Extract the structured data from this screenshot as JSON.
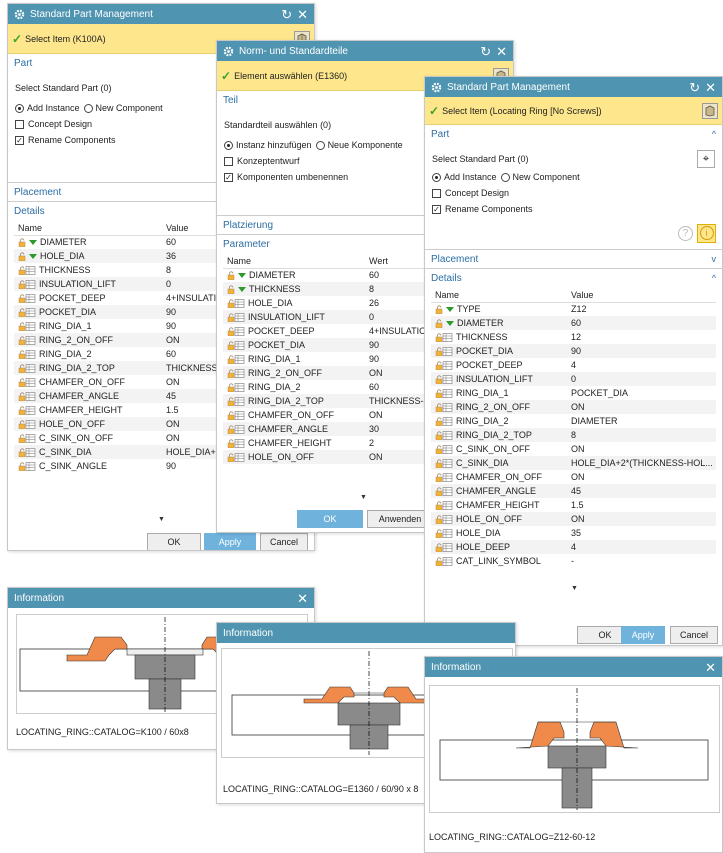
{
  "d1": {
    "title": "Standard Part Management",
    "select": "Select Item (K100A)",
    "part": "Part",
    "select_std": "Select Standard Part (0)",
    "add_instance": "Add Instance",
    "new_component": "New Component",
    "concept": "Concept Design",
    "rename": "Rename Components",
    "placement": "Placement",
    "details": "Details",
    "col_name": "Name",
    "col_value": "Value",
    "rows": [
      {
        "name": "DIAMETER",
        "value": "60",
        "icon": "expression-arrow"
      },
      {
        "name": "HOLE_DIA",
        "value": "36",
        "icon": "expression-arrow"
      },
      {
        "name": "THICKNESS",
        "value": "8",
        "icon": "expression-table"
      },
      {
        "name": "INSULATION_LIFT",
        "value": "0",
        "icon": "expression-table"
      },
      {
        "name": "POCKET_DEEP",
        "value": "4+INSULATIO",
        "icon": "expression-table"
      },
      {
        "name": "POCKET_DIA",
        "value": "90",
        "icon": "expression-table"
      },
      {
        "name": "RING_DIA_1",
        "value": "90",
        "icon": "expression-table"
      },
      {
        "name": "RING_2_ON_OFF",
        "value": "ON",
        "icon": "expression-table"
      },
      {
        "name": "RING_DIA_2",
        "value": "60",
        "icon": "expression-table"
      },
      {
        "name": "RING_DIA_2_TOP",
        "value": "THICKNESS-P",
        "icon": "expression-table"
      },
      {
        "name": "CHAMFER_ON_OFF",
        "value": "ON",
        "icon": "expression-table"
      },
      {
        "name": "CHAMFER_ANGLE",
        "value": "45",
        "icon": "expression-table"
      },
      {
        "name": "CHAMFER_HEIGHT",
        "value": "1.5",
        "icon": "expression-table"
      },
      {
        "name": "HOLE_ON_OFF",
        "value": "ON",
        "icon": "expression-table"
      },
      {
        "name": "C_SINK_ON_OFF",
        "value": "ON",
        "icon": "expression-table"
      },
      {
        "name": "C_SINK_DIA",
        "value": "HOLE_DIA+((",
        "icon": "expression-table"
      },
      {
        "name": "C_SINK_ANGLE",
        "value": "90",
        "icon": "expression-table"
      }
    ],
    "ok": "OK",
    "apply": "Apply",
    "cancel": "Cancel"
  },
  "d2": {
    "title": "Norm- und Standardteile",
    "select": "Element auswählen (E1360)",
    "part": "Teil",
    "select_std": "Standardteil auswählen (0)",
    "add_instance": "Instanz hinzufügen",
    "new_component": "Neue Komponente",
    "concept": "Konzeptentwurf",
    "rename": "Komponenten umbenennen",
    "placement": "Platzierung",
    "details": "Parameter",
    "col_name": "Name",
    "col_value": "Wert",
    "rows": [
      {
        "name": "DIAMETER",
        "value": "60",
        "icon": "expression-arrow"
      },
      {
        "name": "THICKNESS",
        "value": "8",
        "icon": "expression-arrow"
      },
      {
        "name": "HOLE_DIA",
        "value": "26",
        "icon": "expression-table"
      },
      {
        "name": "INSULATION_LIFT",
        "value": "0",
        "icon": "expression-table"
      },
      {
        "name": "POCKET_DEEP",
        "value": "4+INSULATIO",
        "icon": "expression-table"
      },
      {
        "name": "POCKET_DIA",
        "value": "90",
        "icon": "expression-table"
      },
      {
        "name": "RING_DIA_1",
        "value": "90",
        "icon": "expression-table"
      },
      {
        "name": "RING_2_ON_OFF",
        "value": "ON",
        "icon": "expression-table"
      },
      {
        "name": "RING_DIA_2",
        "value": "60",
        "icon": "expression-table"
      },
      {
        "name": "RING_DIA_2_TOP",
        "value": "THICKNESS-P",
        "icon": "expression-table"
      },
      {
        "name": "CHAMFER_ON_OFF",
        "value": "ON",
        "icon": "expression-table"
      },
      {
        "name": "CHAMFER_ANGLE",
        "value": "30",
        "icon": "expression-table"
      },
      {
        "name": "CHAMFER_HEIGHT",
        "value": "2",
        "icon": "expression-table"
      },
      {
        "name": "HOLE_ON_OFF",
        "value": "ON",
        "icon": "expression-table"
      }
    ],
    "ok": "OK",
    "apply": "Anwenden"
  },
  "d3": {
    "title": "Standard Part Management",
    "select": "Select Item (Locating Ring [No Screws])",
    "part": "Part",
    "select_std": "Select Standard Part (0)",
    "add_instance": "Add Instance",
    "new_component": "New Component",
    "concept": "Concept Design",
    "rename": "Rename Components",
    "placement": "Placement",
    "details": "Details",
    "col_name": "Name",
    "col_value": "Value",
    "rows": [
      {
        "name": "TYPE",
        "value": "Z12",
        "icon": "expression-arrow"
      },
      {
        "name": "DIAMETER",
        "value": "60",
        "icon": "expression-arrow"
      },
      {
        "name": "THICKNESS",
        "value": "12",
        "icon": "expression-table"
      },
      {
        "name": "POCKET_DIA",
        "value": "90",
        "icon": "expression-table"
      },
      {
        "name": "POCKET_DEEP",
        "value": "4",
        "icon": "expression-table"
      },
      {
        "name": "INSULATION_LIFT",
        "value": "0",
        "icon": "expression-table"
      },
      {
        "name": "RING_DIA_1",
        "value": "POCKET_DIA",
        "icon": "expression-table"
      },
      {
        "name": "RING_2_ON_OFF",
        "value": "ON",
        "icon": "expression-table"
      },
      {
        "name": "RING_DIA_2",
        "value": "DIAMETER",
        "icon": "expression-table"
      },
      {
        "name": "RING_DIA_2_TOP",
        "value": "8",
        "icon": "expression-table"
      },
      {
        "name": "C_SINK_ON_OFF",
        "value": "ON",
        "icon": "expression-table"
      },
      {
        "name": "C_SINK_DIA",
        "value": "HOLE_DIA+2*(THICKNESS-HOL...",
        "icon": "expression-table"
      },
      {
        "name": "CHAMFER_ON_OFF",
        "value": "ON",
        "icon": "expression-table"
      },
      {
        "name": "CHAMFER_ANGLE",
        "value": "45",
        "icon": "expression-table"
      },
      {
        "name": "CHAMFER_HEIGHT",
        "value": "1.5",
        "icon": "expression-table"
      },
      {
        "name": "HOLE_ON_OFF",
        "value": "ON",
        "icon": "expression-table"
      },
      {
        "name": "HOLE_DIA",
        "value": "35",
        "icon": "expression-table"
      },
      {
        "name": "HOLE_DEEP",
        "value": "4",
        "icon": "expression-table"
      },
      {
        "name": "CAT_LINK_SYMBOL",
        "value": "-",
        "icon": "expression-table"
      }
    ],
    "ok": "OK",
    "apply": "Apply",
    "cancel": "Cancel"
  },
  "i1": {
    "title": "Information",
    "caption": "LOCATING_RING::CATALOG=K100 / 60x8"
  },
  "i2": {
    "title": "Information",
    "caption": "LOCATING_RING::CATALOG=E1360 / 60/90 x 8"
  },
  "i3": {
    "title": "Information",
    "caption": "LOCATING_RING::CATALOG=Z12-60-12"
  },
  "colors": {
    "titlebar": "#4f94b0",
    "selection": "#fde68c",
    "accent": "#2c6ea4",
    "ring": "#f08a4b",
    "bushing": "#8a8a8a"
  }
}
